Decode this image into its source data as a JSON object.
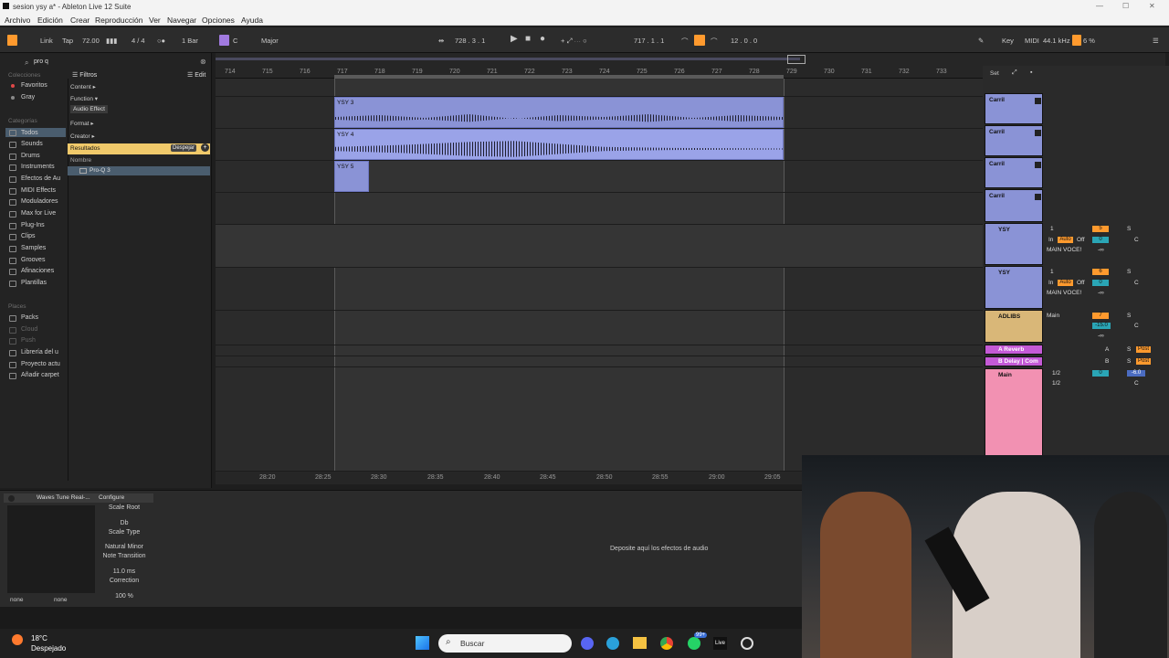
{
  "window": {
    "title": "sesion ysy a* - Ableton Live 12 Suite"
  },
  "menu": [
    "Archivo",
    "Edición",
    "Crear",
    "Reproducción",
    "Ver",
    "Navegar",
    "Opciones",
    "Ayuda"
  ],
  "control": {
    "link": "Link",
    "tap": "Tap",
    "tempo": "72.00",
    "signature": "4 / 4",
    "quantize": "1 Bar",
    "key_root": "C",
    "scale": "Major",
    "position": "728 .  3 .  1",
    "loop_start": "717 .  1 .  1",
    "loop_length": "12 .  0 .  0",
    "key_label": "Key",
    "midi_label": "MIDI",
    "sample_rate": "44.1 kHz",
    "cpu": "6 %"
  },
  "browser": {
    "search": "pro q",
    "filters_label": "Filtros",
    "edit_label": "Edit",
    "collections_head": "Colecciones",
    "collections": [
      "Favoritos",
      "Gray"
    ],
    "categories_head": "Categorías",
    "categories": [
      "Todos",
      "Sounds",
      "Drums",
      "Instruments",
      "Efectos de Au",
      "MIDI Effects",
      "Moduladores",
      "Max for Live",
      "Plug-Ins",
      "Clips",
      "Samples",
      "Grooves",
      "Afinaciones",
      "Plantillas"
    ],
    "places_head": "Places",
    "places": [
      "Packs",
      "Cloud",
      "Push",
      "Librería del u",
      "Proyecto actu",
      "Añadir carpet"
    ],
    "filter_content": "Content",
    "filter_function": "Function",
    "filter_audio_effect": "Audio Effect",
    "filter_format": "Format",
    "filter_creator": "Creator",
    "results_label": "Resultados",
    "clear_label": "Despejar",
    "name_header": "Nombre",
    "result_item": "Pro-Q 3"
  },
  "ruler": [
    "714",
    "715",
    "716",
    "717",
    "718",
    "719",
    "720",
    "721",
    "722",
    "723",
    "724",
    "725",
    "726",
    "727",
    "728",
    "729",
    "730",
    "731",
    "732",
    "733"
  ],
  "timebar": [
    "28:20",
    "28:25",
    "28:30",
    "28:35",
    "28:40",
    "28:45",
    "28:50",
    "28:55",
    "29:00",
    "29:05"
  ],
  "clips": [
    "YSY 3",
    "YSY 4",
    "YSY 5"
  ],
  "mixer": {
    "tracks": [
      {
        "name": "Carril"
      },
      {
        "name": "Carril"
      },
      {
        "name": "Carril"
      },
      {
        "name": "Carril"
      }
    ],
    "ysy1": {
      "name": "YSY",
      "input": "1",
      "in": "In",
      "auto": "Auto",
      "off": "Off",
      "out": "MAIN VOCE!",
      "num": "5",
      "s": "S",
      "vol": "0",
      "pan": "C",
      "inf": "-∞"
    },
    "ysy2": {
      "name": "YSY",
      "input": "1",
      "in": "In",
      "auto": "Auto",
      "off": "Off",
      "out": "MAIN VOCE!",
      "num": "6",
      "s": "S",
      "vol": "0",
      "pan": "C",
      "inf": "-∞"
    },
    "adlibs": {
      "name": "ADLIBS",
      "out": "Main",
      "num": "7",
      "s": "S",
      "vol": "-15.0",
      "pan": "C",
      "inf": "-∞"
    },
    "reverb": {
      "name": "A Reverb",
      "letter": "A",
      "s": "S",
      "post": "Post"
    },
    "delay": {
      "name": "B Delay | Com",
      "letter": "B",
      "s": "S",
      "post": "Post"
    },
    "main": {
      "name": "Main",
      "out1": "1/2",
      "out2": "1/2",
      "vol": "0",
      "db": "-6.0",
      "pan": "C"
    }
  },
  "device": {
    "name": "Waves Tune Real-...",
    "configure": "Configure",
    "scale_root_label": "Scale Root",
    "scale_root": "Db",
    "scale_type_label": "Scale Type",
    "scale_type": "Natural Minor",
    "note_transition_label": "Note Transition",
    "note_transition": "11.0 ms",
    "correction_label": "Correction",
    "correction": "100 %",
    "sel1": "none",
    "sel2": "none",
    "drop_hint": "Deposite aquí los efectos de audio"
  },
  "taskbar": {
    "temp": "18°C",
    "weather": "Despejado",
    "search": "Buscar",
    "badge": "99+"
  },
  "colors": {
    "clip": "#8a93d6",
    "adlibs": "#d9b778",
    "main": "#f291b2",
    "send": "#c45ad6",
    "accent": "#ff9a2e"
  }
}
